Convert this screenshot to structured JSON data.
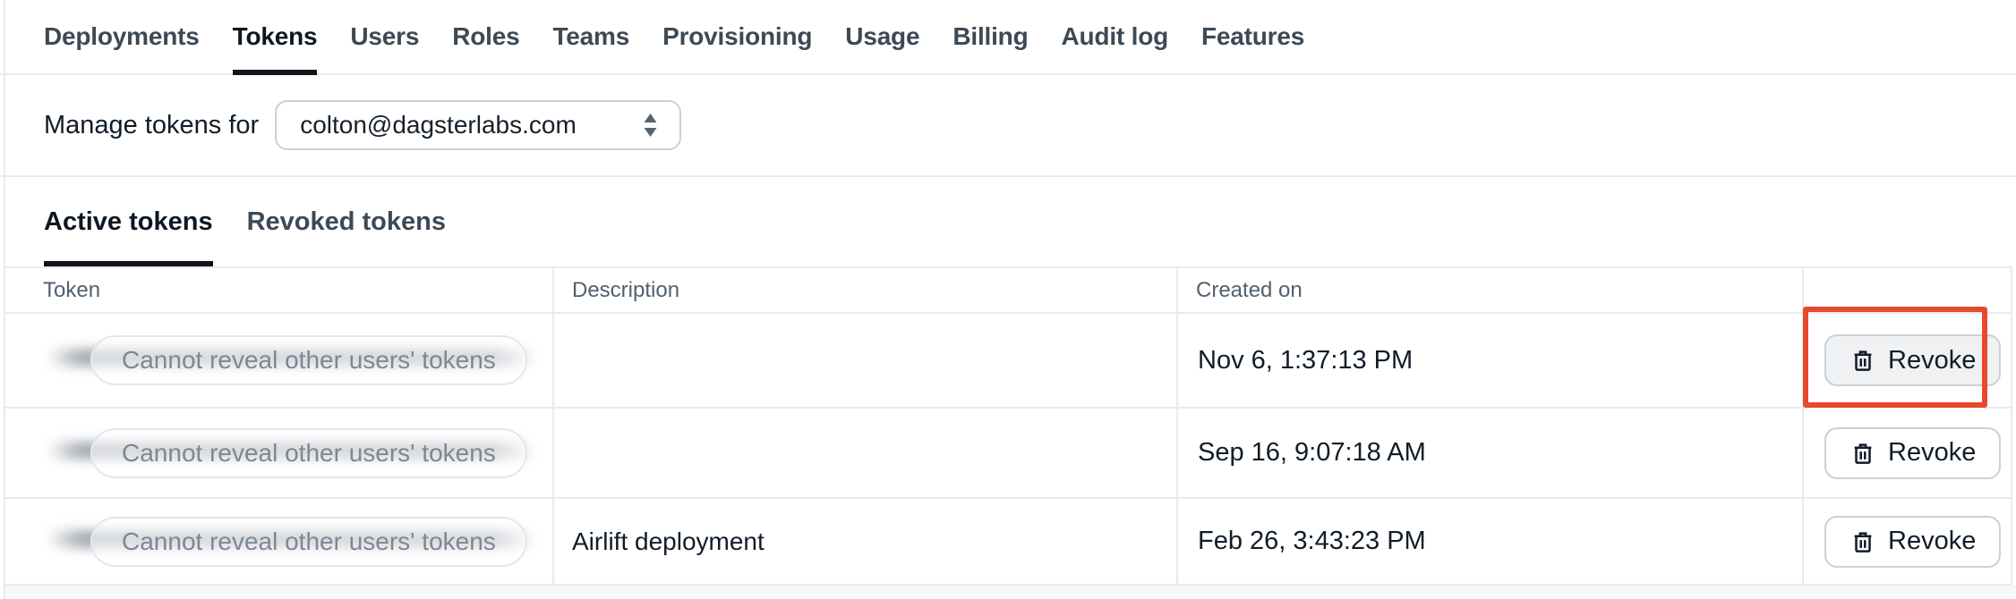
{
  "nav": {
    "tabs": [
      {
        "label": "Deployments",
        "active": false
      },
      {
        "label": "Tokens",
        "active": true
      },
      {
        "label": "Users",
        "active": false
      },
      {
        "label": "Roles",
        "active": false
      },
      {
        "label": "Teams",
        "active": false
      },
      {
        "label": "Provisioning",
        "active": false
      },
      {
        "label": "Usage",
        "active": false
      },
      {
        "label": "Billing",
        "active": false
      },
      {
        "label": "Audit log",
        "active": false
      },
      {
        "label": "Features",
        "active": false
      }
    ]
  },
  "manage": {
    "label": "Manage tokens for",
    "selected_user": "colton@dagsterlabs.com",
    "dropdown_icon": "double-caret-vertical-icon"
  },
  "subtabs": {
    "items": [
      {
        "label": "Active tokens",
        "active": true
      },
      {
        "label": "Revoked tokens",
        "active": false
      }
    ]
  },
  "table": {
    "columns": {
      "token": "Token",
      "description": "Description",
      "created_on": "Created on",
      "actions": ""
    },
    "rows": [
      {
        "masked": "Cannot reveal other users' tokens",
        "description": "",
        "created_on": "Nov 6, 1:37:13 PM",
        "action": "Revoke",
        "action_icon": "trash-icon",
        "annotated": true
      },
      {
        "masked": "Cannot reveal other users' tokens",
        "description": "",
        "created_on": "Sep 16, 9:07:18 AM",
        "action": "Revoke",
        "action_icon": "trash-icon",
        "annotated": false
      },
      {
        "masked": "Cannot reveal other users' tokens",
        "description": "Airlift deployment",
        "created_on": "Feb 26, 3:43:23 PM",
        "action": "Revoke",
        "action_icon": "trash-icon",
        "annotated": false
      }
    ]
  },
  "annotation": {
    "type": "highlight-box",
    "target": "first-revoke-button",
    "color": "#E8492D"
  }
}
